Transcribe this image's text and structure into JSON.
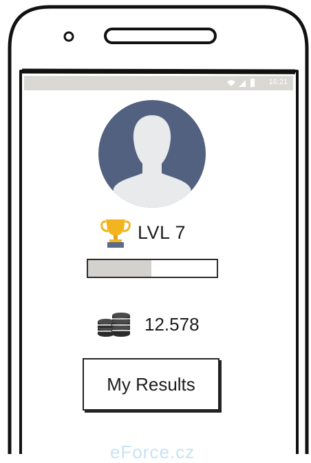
{
  "status_bar": {
    "time": "16:21",
    "icons": [
      "wifi-icon",
      "signal-icon",
      "battery-icon"
    ]
  },
  "profile": {
    "avatar_icon": "user-avatar-icon"
  },
  "level": {
    "icon": "trophy-icon",
    "label": "LVL 7",
    "progress": 0.49
  },
  "coins": {
    "icon": "coins-icon",
    "value": "12.578"
  },
  "actions": {
    "results_label": "My Results"
  },
  "watermark": "eForce.cz",
  "colors": {
    "avatar_bg": "#52617f",
    "avatar_silhouette": "#e8eaec",
    "status_bar": "#dad8d5",
    "progress_fill": "#d4d2cf",
    "trophy_gold": "#f3b51f",
    "trophy_base": "#5a6a8a",
    "watermark": "#c7e3f3"
  }
}
